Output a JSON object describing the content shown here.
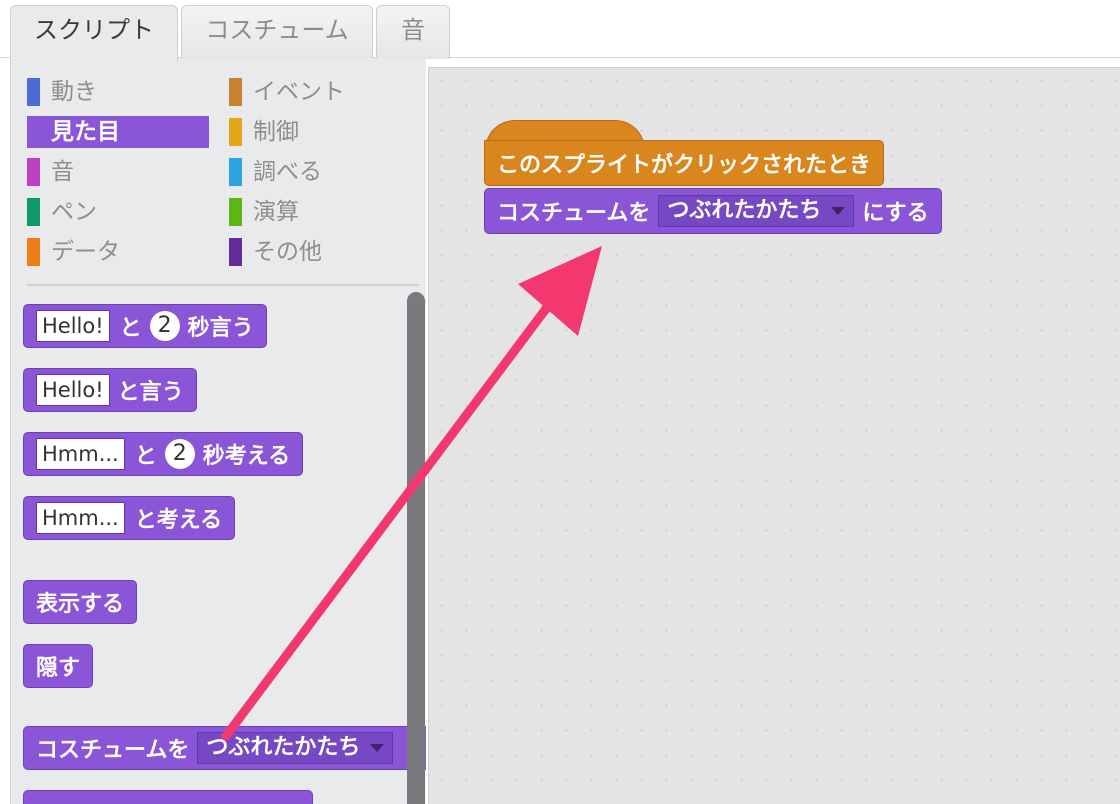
{
  "tabs": [
    "スクリプト",
    "コスチューム",
    "音"
  ],
  "categories": [
    {
      "label": "動き",
      "color": "#4a6cd4"
    },
    {
      "label": "見た目",
      "color": "#8a55d7"
    },
    {
      "label": "音",
      "color": "#bb42c3"
    },
    {
      "label": "ペン",
      "color": "#0e9a6c"
    },
    {
      "label": "データ",
      "color": "#ee7d16"
    },
    {
      "label": "イベント",
      "color": "#c88330"
    },
    {
      "label": "制御",
      "color": "#e1a91a"
    },
    {
      "label": "調べる",
      "color": "#2ca5e2"
    },
    {
      "label": "演算",
      "color": "#5cb712"
    },
    {
      "label": "その他",
      "color": "#632d99"
    }
  ],
  "palette_blocks": {
    "say_for": {
      "text": "Hello!",
      "and": "と",
      "secs": "2",
      "suffix": "秒言う"
    },
    "say": {
      "text": "Hello!",
      "suffix": "と言う"
    },
    "think_for": {
      "text": "Hmm...",
      "and": "と",
      "secs": "2",
      "suffix": "秒考える"
    },
    "think": {
      "text": "Hmm...",
      "suffix": "と考える"
    },
    "show": "表示する",
    "hide": "隠す",
    "switch_costume": {
      "prefix": "コスチュームを",
      "value": "つぶれたかたち"
    }
  },
  "script": {
    "hat": "このスプライトがクリックされたとき",
    "switch_costume": {
      "prefix": "コスチュームを",
      "value": "つぶれたかたち",
      "suffix": "にする"
    }
  },
  "colors": {
    "looks": "#8a55d7",
    "events": "#d9861f",
    "arrow": "#f2386e"
  }
}
